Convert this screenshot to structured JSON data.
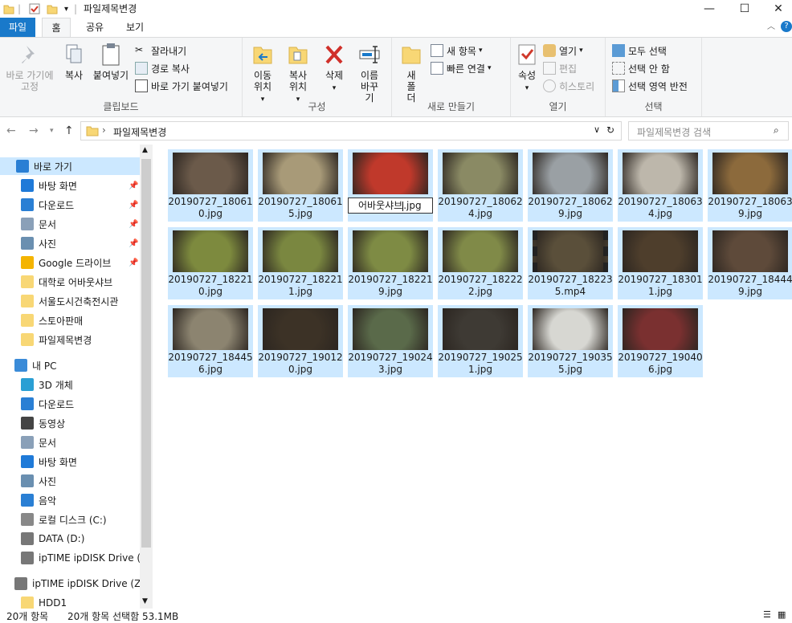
{
  "window": {
    "title": "파일제목변경"
  },
  "tabs": {
    "file": "파일",
    "home": "홈",
    "share": "공유",
    "view": "보기"
  },
  "ribbon": {
    "clipboard": {
      "label": "클립보드",
      "pin": "바로 가기에 고정",
      "copy": "복사",
      "paste": "붙여넣기",
      "cut": "잘라내기",
      "copy_path": "경로 복사",
      "paste_shortcut": "바로 가기 붙여넣기"
    },
    "organize": {
      "label": "구성",
      "move_to": "이동 위치",
      "copy_to": "복사 위치",
      "delete": "삭제",
      "rename": "이름 바꾸기"
    },
    "new": {
      "label": "새로 만들기",
      "new_folder": "새 폴더",
      "new_item": "새 항목",
      "easy_access": "빠른 연결"
    },
    "open": {
      "label": "열기",
      "properties": "속성",
      "open": "열기",
      "edit": "편집",
      "history": "히스토리"
    },
    "select": {
      "label": "선택",
      "select_all": "모두 선택",
      "select_none": "선택 안 함",
      "invert": "선택 영역 반전"
    }
  },
  "address": {
    "path": "파일제목변경",
    "search_placeholder": "파일제목변경 검색"
  },
  "nav": {
    "quick_access": "바로 가기",
    "quick_items": [
      "바탕 화면",
      "다운로드",
      "문서",
      "사진",
      "Google 드라이브",
      "대학로 어바웃샤브",
      "서울도시건축전시관",
      "스토아판매",
      "파일제목변경"
    ],
    "pc": "내 PC",
    "pc_items": [
      "3D 개체",
      "다운로드",
      "동영상",
      "문서",
      "바탕 화면",
      "사진",
      "음악",
      "로컬 디스크 (C:)",
      "DATA (D:)",
      "ipTIME ipDISK Drive (Z:)"
    ],
    "network_drive": "ipTIME ipDISK Drive (Z:)",
    "hdd": "HDD1"
  },
  "files": [
    {
      "name": "20190727_180610.jpg",
      "color": "#6b5a4a"
    },
    {
      "name": "20190727_180615.jpg",
      "color": "#a89a78"
    },
    {
      "name": "어바웃샤브.jpg",
      "color": "#c0392b",
      "renaming": true,
      "edit_text": "어바웃샤브",
      "edit_ext": ".jpg"
    },
    {
      "name": "20190727_180624.jpg",
      "color": "#8a8a64"
    },
    {
      "name": "20190727_180629.jpg",
      "color": "#9aa0a4"
    },
    {
      "name": "20190727_180634.jpg",
      "color": "#bdb7ab"
    },
    {
      "name": "20190727_180639.jpg",
      "color": "#8c6a3c"
    },
    {
      "name": "20190727_182210.jpg",
      "color": "#7d8a3e"
    },
    {
      "name": "20190727_182211.jpg",
      "color": "#7a8740"
    },
    {
      "name": "20190727_182219.jpg",
      "color": "#7e8b44"
    },
    {
      "name": "20190727_182222.jpg",
      "color": "#808a48"
    },
    {
      "name": "20190727_182235.mp4",
      "color": "#5a4f3a",
      "video": true
    },
    {
      "name": "20190727_183011.jpg",
      "color": "#4e3e2c"
    },
    {
      "name": "20190727_184449.jpg",
      "color": "#5e4a3a"
    },
    {
      "name": "20190727_184456.jpg",
      "color": "#8c8470"
    },
    {
      "name": "20190727_190120.jpg",
      "color": "#3c3226"
    },
    {
      "name": "20190727_190243.jpg",
      "color": "#5a6a4a"
    },
    {
      "name": "20190727_190251.jpg",
      "color": "#3e3a34"
    },
    {
      "name": "20190727_190355.jpg",
      "color": "#d7d7d2"
    },
    {
      "name": "20190727_190406.jpg",
      "color": "#7a3030"
    }
  ],
  "status": {
    "count": "20개 항목",
    "selected": "20개 항목 선택함 53.1MB"
  },
  "colors": {
    "accent": "#1979ca",
    "selection": "#cce8ff",
    "folder": "#f8d775"
  }
}
